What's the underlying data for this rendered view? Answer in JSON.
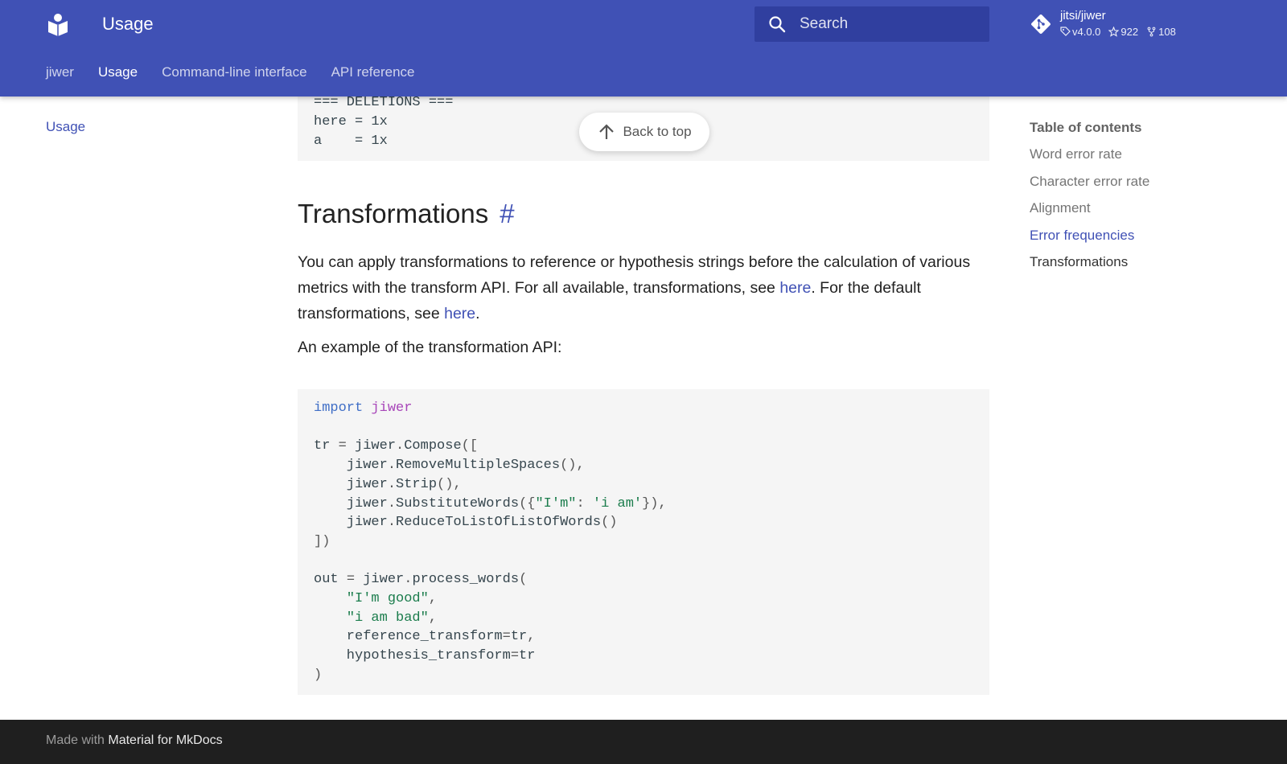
{
  "header": {
    "title": "Usage",
    "search_placeholder": "Search",
    "repo": {
      "name": "jitsi/jiwer",
      "version": "v4.0.0",
      "stars": "922",
      "forks": "108"
    },
    "tabs": [
      {
        "label": "jiwer"
      },
      {
        "label": "Usage"
      },
      {
        "label": "Command-line interface"
      },
      {
        "label": "API reference"
      }
    ]
  },
  "left_nav": {
    "items": [
      {
        "label": "Usage"
      }
    ]
  },
  "code_top": {
    "lines": [
      "=== DELETIONS ===",
      "here = 1x",
      "a    = 1x"
    ]
  },
  "back_to_top": "Back to top",
  "section": {
    "heading": "Transformations",
    "anchor": "#",
    "para_1": "You can apply transformations to reference or hypothesis strings before the calculation of various metrics with the transform API. For all available, transformations, see ",
    "link_1": "here",
    "para_2": ". For the default transformations, see ",
    "link_2": "here",
    "para_3": ".",
    "example_intro": "An example of the transformation API:"
  },
  "toc": {
    "title": "Table of contents",
    "items": [
      {
        "label": "Word error rate"
      },
      {
        "label": "Character error rate"
      },
      {
        "label": "Alignment"
      },
      {
        "label": "Error frequencies"
      },
      {
        "label": "Transformations"
      }
    ]
  },
  "footer": {
    "made_with": "Made with",
    "link": "Material for MkDocs"
  },
  "colors": {
    "primary": "#4051b5",
    "search_bg": "#303f9f",
    "footer_bg": "#1f1f1f",
    "code_bg": "#f5f5f5"
  }
}
